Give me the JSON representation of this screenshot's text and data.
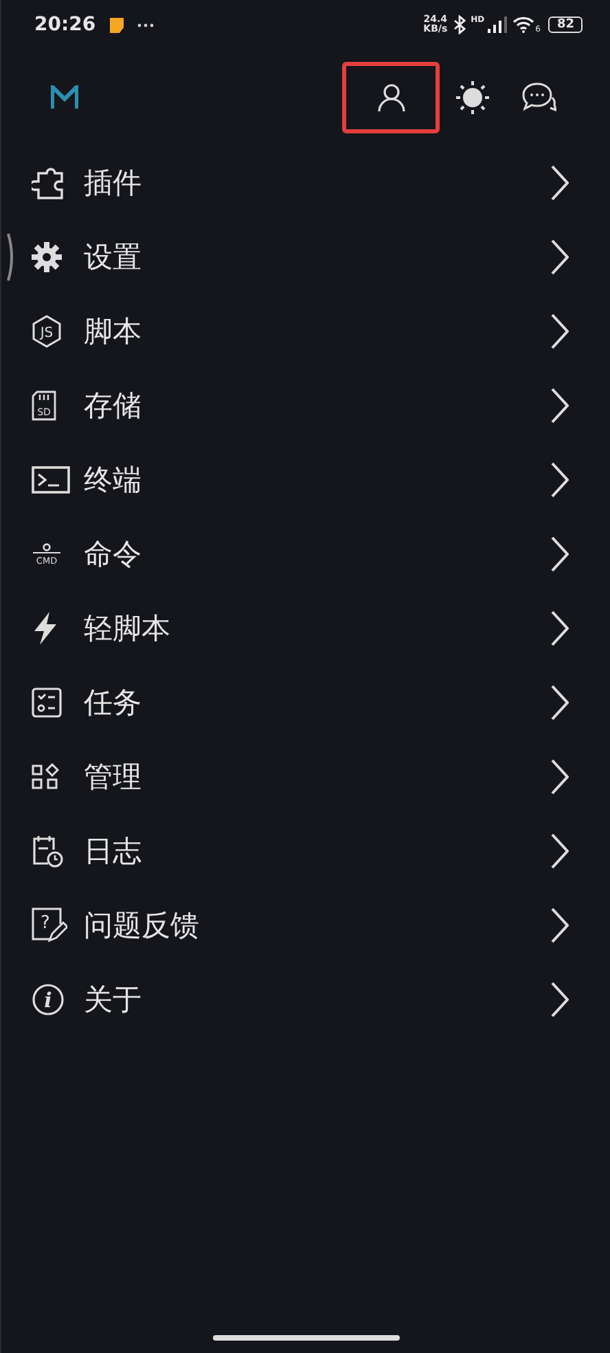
{
  "status_bar": {
    "time": "20:26",
    "speed": "24.4",
    "speed_unit": "KB/s",
    "network": "HD",
    "wifi_standard": "6",
    "battery": "82"
  },
  "header": {
    "actions": [
      {
        "kind": "profile",
        "highlighted": true
      },
      {
        "kind": "theme",
        "highlighted": false
      },
      {
        "kind": "chat",
        "highlighted": false
      }
    ]
  },
  "menu": [
    {
      "kind": "puzzle",
      "label": "插件"
    },
    {
      "kind": "gear",
      "label": "设置"
    },
    {
      "kind": "js",
      "label": "脚本",
      "icon_text": "JS"
    },
    {
      "kind": "sd",
      "label": "存储",
      "icon_text": "SD"
    },
    {
      "kind": "terminal",
      "label": "终端"
    },
    {
      "kind": "cmd",
      "label": "命令",
      "icon_text": "CMD"
    },
    {
      "kind": "bolt",
      "label": "轻脚本"
    },
    {
      "kind": "tasks",
      "label": "任务"
    },
    {
      "kind": "grid",
      "label": "管理"
    },
    {
      "kind": "log",
      "label": "日志"
    },
    {
      "kind": "feedback",
      "label": "问题反馈",
      "icon_text": "?"
    },
    {
      "kind": "info",
      "label": "关于",
      "icon_text": "i"
    }
  ]
}
